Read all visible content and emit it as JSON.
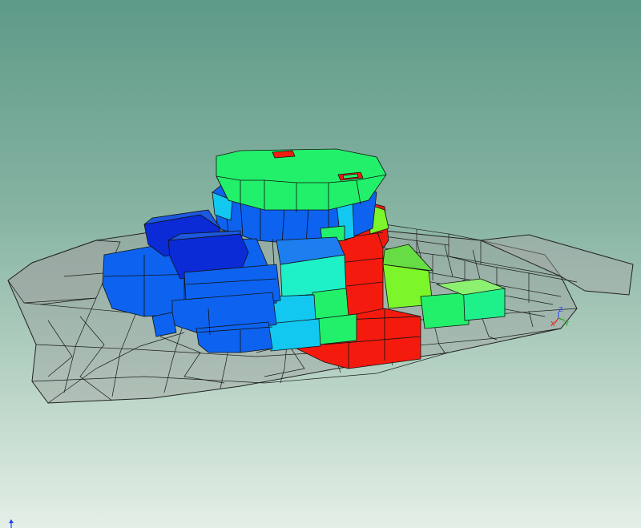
{
  "viewport": {
    "background_top": "#5e9a88",
    "background_bottom": "#e4efe7"
  },
  "triad": {
    "x_label": "X",
    "y_label": "Y",
    "z_label": "Z",
    "x_color": "#ff0000",
    "y_color": "#00b000",
    "z_color": "#2040ff"
  },
  "legend_colors": {
    "dark_blue": "#0a2bd6",
    "blue": "#0d63f0",
    "cyan": "#12c8f0",
    "aqua": "#1ef0c8",
    "green": "#22f06a",
    "lime": "#7cf52a",
    "red": "#f51a0e"
  }
}
